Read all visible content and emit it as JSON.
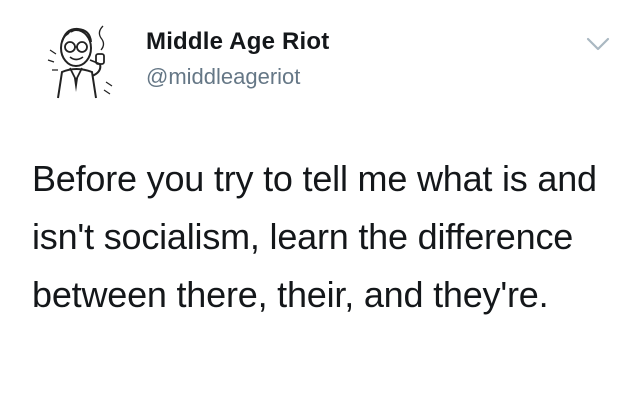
{
  "user": {
    "display_name": "Middle Age Riot",
    "handle": "@middleageriot",
    "avatar_icon": "vintage-man-pipe-illustration"
  },
  "tweet": {
    "text": "Before you try to tell me what is and isn't socialism, learn the difference between there, their, and they're."
  },
  "header": {
    "menu_icon": "chevron-down-icon"
  },
  "colors": {
    "text": "#14171a",
    "secondary": "#657786",
    "chevron": "#aab8c2"
  }
}
